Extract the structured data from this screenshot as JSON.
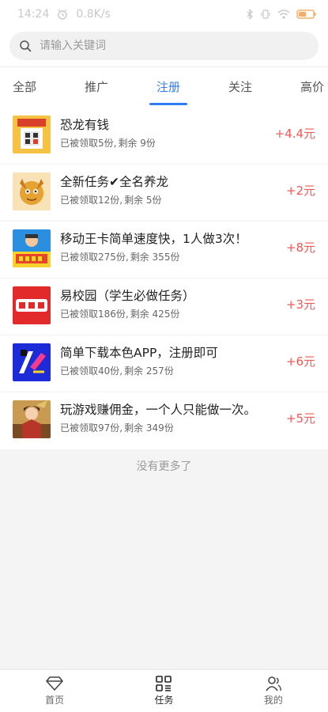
{
  "status_bar": {
    "time": "14:24",
    "speed": "0.8K/s"
  },
  "search": {
    "placeholder": "请输入关键词"
  },
  "tabs": [
    {
      "label": "全部",
      "active": false
    },
    {
      "label": "推广",
      "active": false
    },
    {
      "label": "注册",
      "active": true
    },
    {
      "label": "关注",
      "active": false
    },
    {
      "label": "高价",
      "active": false
    }
  ],
  "tasks": [
    {
      "title": "恐龙有钱",
      "claimed_label": "已被领取5份,",
      "remaining_label": "剩余 9份",
      "reward": "+4.4元",
      "icon": "dinosaur-money-icon"
    },
    {
      "title": "全新任务✔全名养龙",
      "claimed_label": "已被领取12份,",
      "remaining_label": "剩余 5份",
      "reward": "+2元",
      "icon": "dragon-icon"
    },
    {
      "title": "移动王卡简单速度快，1人做3次！",
      "claimed_label": "已被领取275份,",
      "remaining_label": "剩余 355份",
      "reward": "+8元",
      "icon": "mobile-king-card-icon"
    },
    {
      "title": "易校园（学生必做任务）",
      "claimed_label": "已被领取186份,",
      "remaining_label": "剩余 425份",
      "reward": "+3元",
      "icon": "yi-xiao-yuan-icon"
    },
    {
      "title": "简单下载本色APP，注册即可",
      "claimed_label": "已被领取40份,",
      "remaining_label": "剩余 257份",
      "reward": "+6元",
      "icon": "bense-app-icon"
    },
    {
      "title": "玩游戏赚佣金，一个人只能做一次。",
      "claimed_label": "已被领取97份,",
      "remaining_label": "剩余 349份",
      "reward": "+5元",
      "icon": "game-character-icon"
    }
  ],
  "no_more_text": "没有更多了",
  "bottom_nav": [
    {
      "label": "首页",
      "icon": "diamond-icon",
      "active": false
    },
    {
      "label": "任务",
      "icon": "grid-icon",
      "active": true
    },
    {
      "label": "我的",
      "icon": "user-icon",
      "active": false
    }
  ],
  "colors": {
    "accent": "#2f7df6",
    "reward": "#f05a5a"
  }
}
